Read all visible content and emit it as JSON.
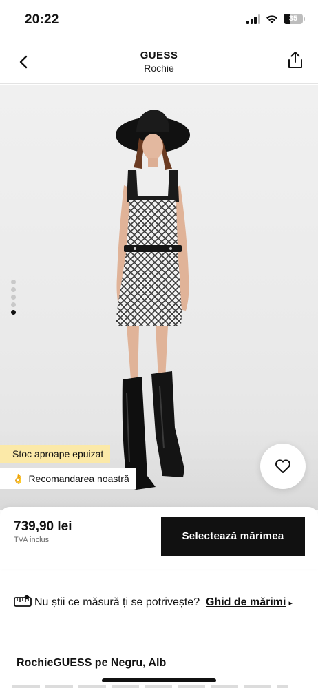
{
  "status_bar": {
    "time": "20:22",
    "battery": "35",
    "battery_level": 0.35
  },
  "header": {
    "brand": "GUESS",
    "category": "Rochie"
  },
  "gallery": {
    "image_count": 5,
    "active_index": 4,
    "stock_tag": "Stoc aproape epuizat",
    "recommendation_emoji": "👌",
    "recommendation_tag": "Recomandarea noastră"
  },
  "price_card": {
    "price": "739,90 lei",
    "vat_note": "TVA inclus",
    "select_size_label": "Selectează mărimea"
  },
  "size_guide": {
    "question": "Nu știi ce măsură ți se potrivește?",
    "link_label": "Ghid de mărimi",
    "arrow": "▸"
  },
  "product": {
    "title": "RochieGUESS pe Negru, Alb"
  },
  "colors": {
    "accent_black": "#111111",
    "stock_tag_bg": "#fbe9a8",
    "background": "#ffffff"
  }
}
